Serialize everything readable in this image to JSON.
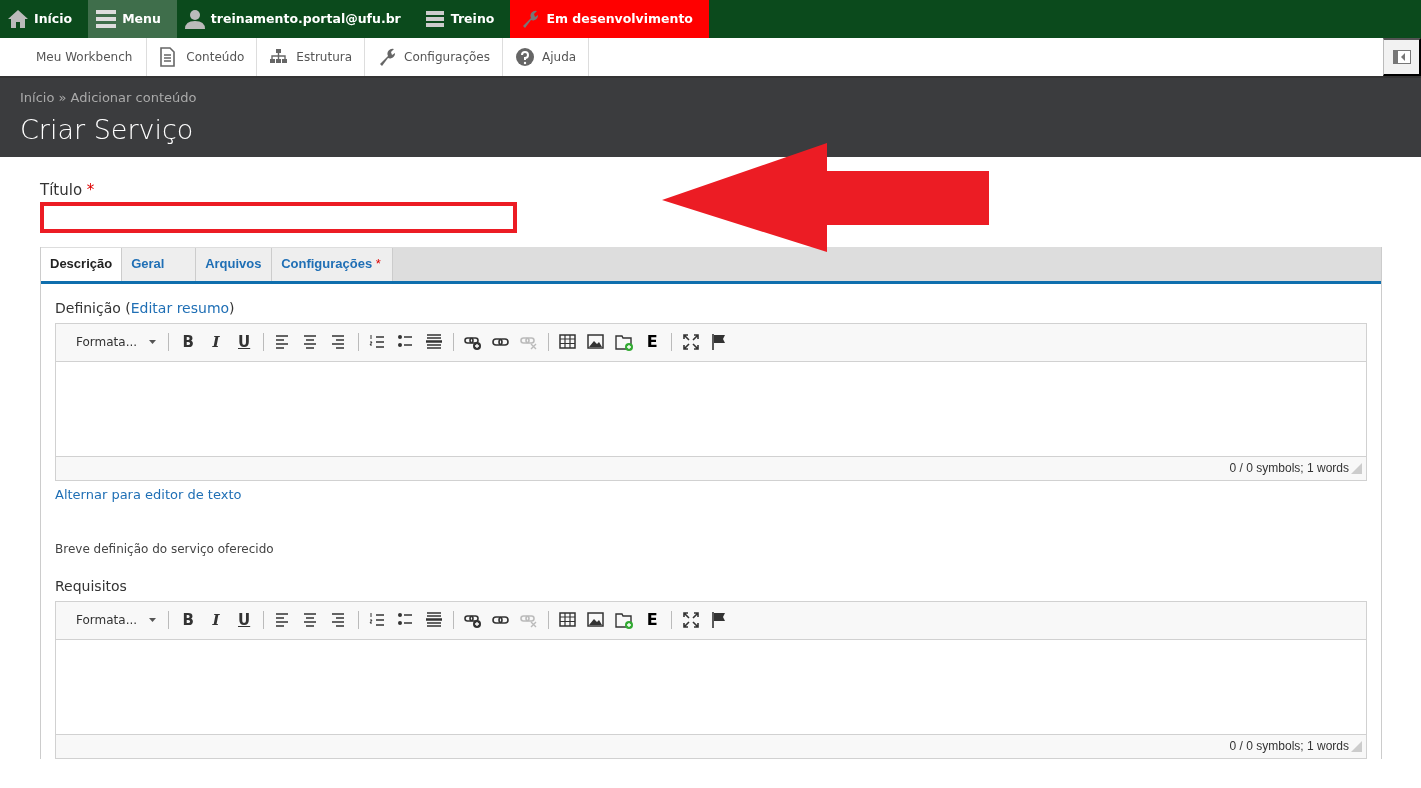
{
  "toolbar": [
    {
      "label": "Início",
      "selected": false,
      "kind": "normal"
    },
    {
      "label": "Menu",
      "selected": true,
      "kind": "normal"
    },
    {
      "label": "treinamento.portal@ufu.br",
      "selected": false,
      "kind": "normal"
    },
    {
      "label": "Treino",
      "selected": false,
      "kind": "normal"
    },
    {
      "label": "Em desenvolvimento",
      "selected": false,
      "kind": "warning"
    }
  ],
  "admin_menu": [
    {
      "label": "Meu Workbench"
    },
    {
      "label": "Conteúdo"
    },
    {
      "label": "Estrutura"
    },
    {
      "label": "Configurações"
    },
    {
      "label": "Ajuda"
    }
  ],
  "header": {
    "breadcrumb": [
      "Início",
      "Adicionar conteúdo"
    ],
    "breadcrumb_separator": "»",
    "title": "Criar Serviço"
  },
  "title_field": {
    "label": "Título",
    "required_mark": "*"
  },
  "tabs": [
    {
      "label": "Descrição",
      "selected": true
    },
    {
      "label": "Geral",
      "selected": false
    },
    {
      "label": "Arquivos",
      "selected": false
    },
    {
      "label": "Configurações",
      "selected": false,
      "required_mark": "*"
    }
  ],
  "editors": [
    {
      "label": "Definição",
      "paren_open": "(",
      "link": "Editar resumo",
      "paren_close": ")",
      "format": "Formata...",
      "bold": "B",
      "italic": "I",
      "underline": "U",
      "e_button": "E",
      "counter": "0 / 0 symbols; 1 words",
      "switch_link": "Alternar para editor de texto",
      "description": "Breve definição do serviço oferecido"
    },
    {
      "label": "Requisitos",
      "format": "Formata...",
      "bold": "B",
      "italic": "I",
      "underline": "U",
      "e_button": "E",
      "counter": "0 / 0 symbols; 1 words"
    }
  ]
}
